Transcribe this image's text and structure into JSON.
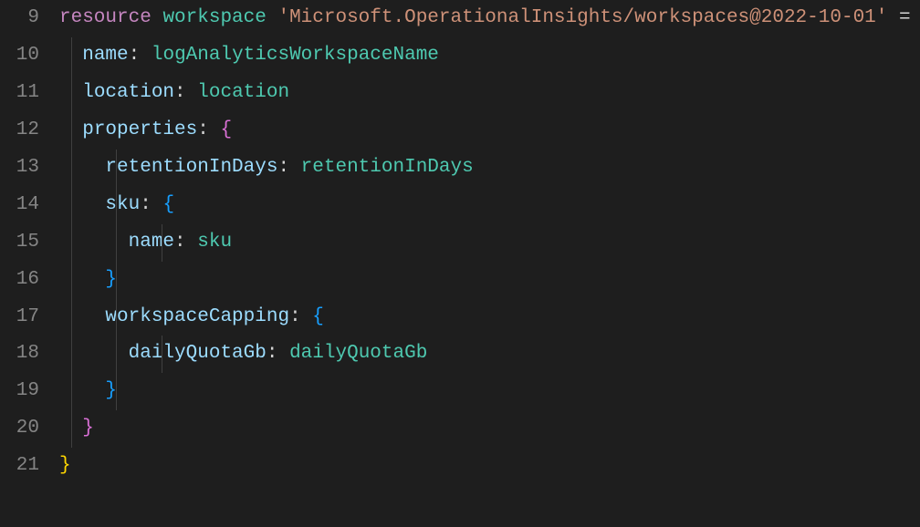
{
  "lineNumbers": [
    "9",
    "10",
    "11",
    "12",
    "13",
    "14",
    "15",
    "16",
    "17",
    "18",
    "19",
    "20",
    "21"
  ],
  "tokens": {
    "resource": "resource",
    "workspace": "workspace",
    "typeString": "'Microsoft.OperationalInsights/workspaces@2022-10-01'",
    "equals": " = ",
    "braceOpen": "{",
    "braceClose": "}",
    "name": "name",
    "colon": ": ",
    "logAnalyticsWorkspaceName": "logAnalyticsWorkspaceName",
    "location": "location",
    "locationVal": "location",
    "properties": "properties",
    "retentionInDays": "retentionInDays",
    "retentionInDaysVal": "retentionInDays",
    "sku": "sku",
    "skuVal": "sku",
    "workspaceCapping": "workspaceCapping",
    "dailyQuotaGb": "dailyQuotaGb",
    "dailyQuotaGbVal": "dailyQuotaGb"
  }
}
